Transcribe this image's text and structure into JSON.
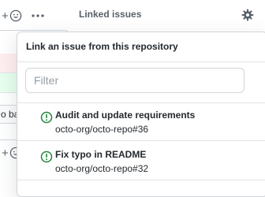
{
  "sidebar": {
    "title": "Linked issues",
    "gear_icon": "gear-icon"
  },
  "timeline": {
    "partial_button_label": "o bat",
    "icons": [
      "add-reaction-icon",
      "kebab-horizontal-icon"
    ],
    "diff_colors": {
      "deleted": "#ffeef0",
      "added": "#e6ffed"
    }
  },
  "popover": {
    "title": "Link an issue from this repository",
    "filter": {
      "placeholder": "Filter",
      "value": ""
    },
    "issues": [
      {
        "title": "Audit and update requirements",
        "reference": "octo-org/octo-repo#36",
        "status_icon": "issue-opened-icon",
        "status_color": "#22863a"
      },
      {
        "title": "Fix typo in README",
        "reference": "octo-org/octo-repo#32",
        "status_icon": "issue-opened-icon",
        "status_color": "#22863a"
      }
    ]
  }
}
